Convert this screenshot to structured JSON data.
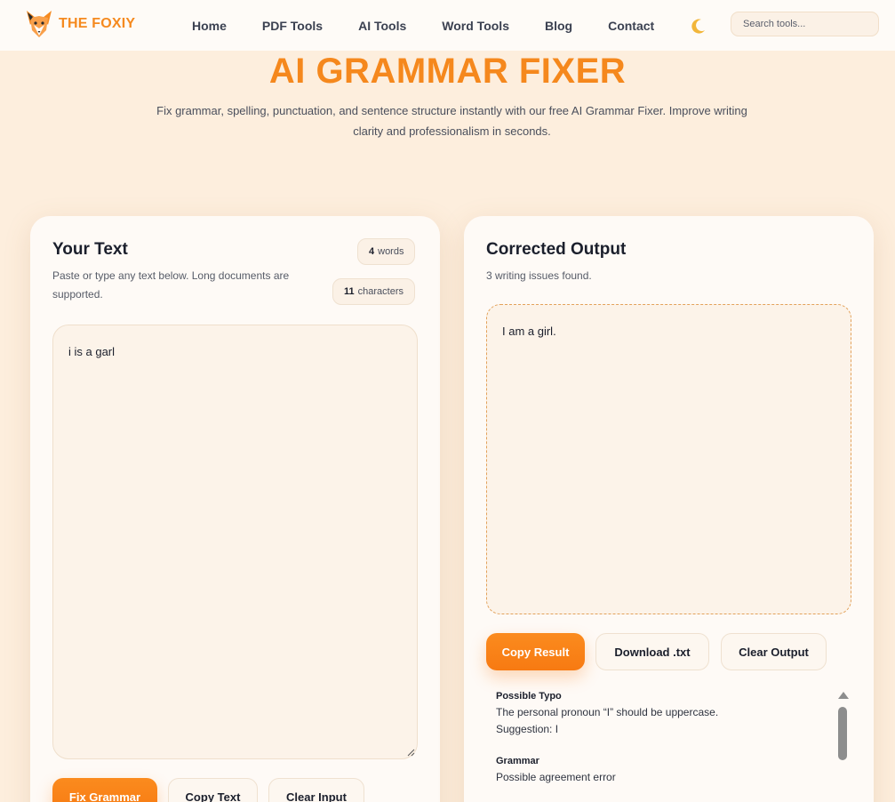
{
  "header": {
    "brand": "THE FOXIY",
    "nav": [
      "Home",
      "PDF Tools",
      "AI Tools",
      "Word Tools",
      "Blog",
      "Contact"
    ],
    "search_placeholder": "Search tools..."
  },
  "hero": {
    "title": "AI GRAMMAR FIXER",
    "description": "Fix grammar, spelling, punctuation, and sentence structure instantly with our free AI Grammar Fixer. Improve writing clarity and professionalism in seconds."
  },
  "input_card": {
    "title": "Your Text",
    "subtitle": "Paste or type any text below. Long documents are supported.",
    "word_count": "4",
    "word_label": "words",
    "char_count": "11",
    "char_label": "characters",
    "input_value": "i is a garl",
    "buttons": {
      "fix": "Fix Grammar",
      "copy": "Copy Text",
      "clear": "Clear Input"
    }
  },
  "output_card": {
    "title": "Corrected Output",
    "subtitle": "3 writing issues found.",
    "output_text": "I am a girl.",
    "buttons": {
      "copy": "Copy Result",
      "download": "Download .txt",
      "clear": "Clear Output"
    },
    "issues": [
      {
        "title": "Possible Typo",
        "lines": [
          "The personal pronoun “I” should be uppercase.",
          "Suggestion: I"
        ]
      },
      {
        "title": "Grammar",
        "lines": [
          "Possible agreement error"
        ]
      }
    ]
  },
  "colors": {
    "accent": "#f5881d",
    "background": "#fdeedd",
    "card": "#fefaf6"
  }
}
